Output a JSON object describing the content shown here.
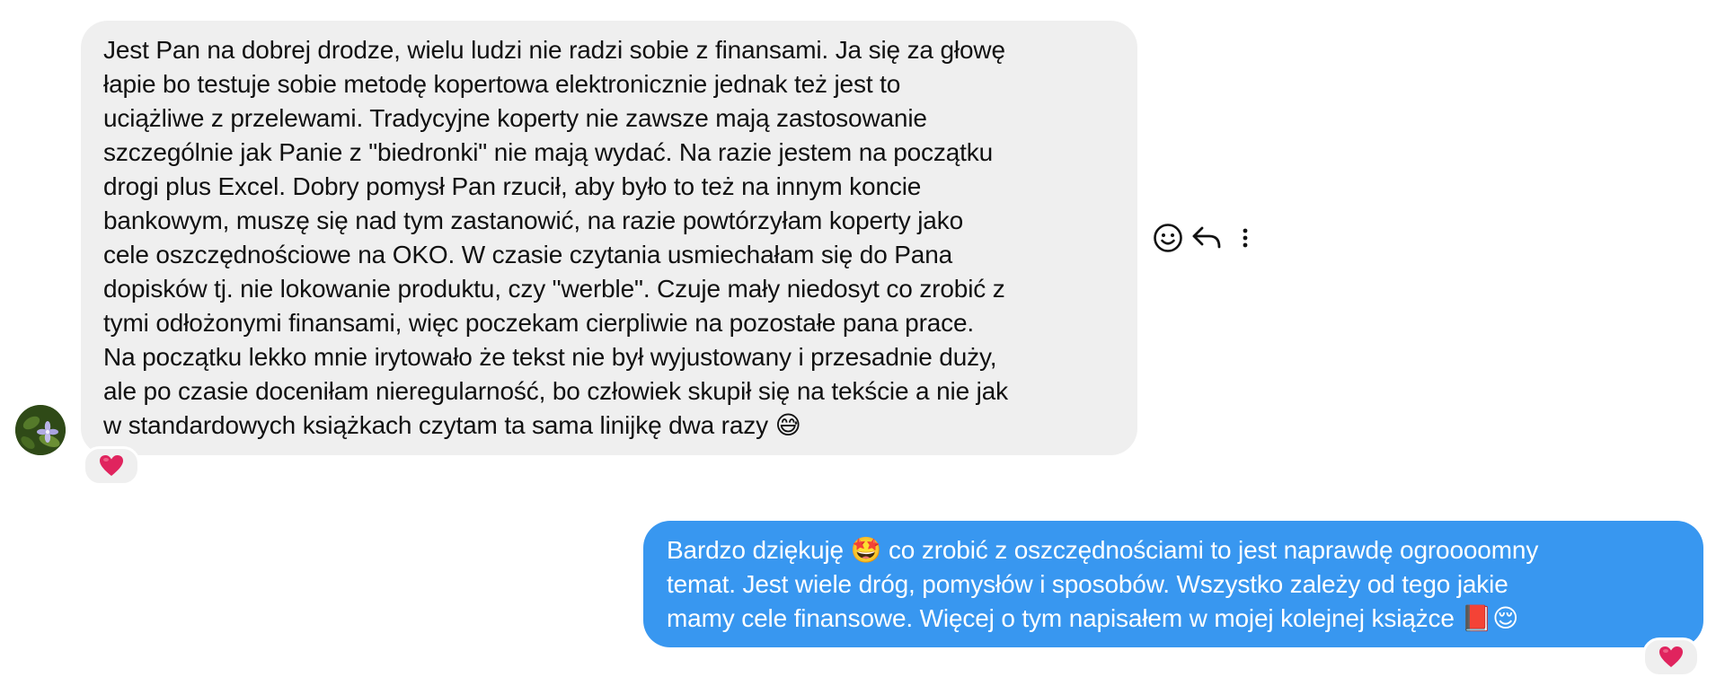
{
  "incoming_message": {
    "lines": [
      "Jest Pan na dobrej drodze, wielu ludzi nie radzi sobie z finansami. Ja się za głowę",
      "łapie bo testuje sobie metodę kopertowa elektronicznie jednak też jest to",
      "uciążliwe z przelewami. Tradycyjne koperty nie zawsze mają zastosowanie",
      "szczególnie jak Panie z \"biedronki\" nie mają wydać. Na razie jestem na początku",
      "drogi plus Excel. Dobry pomysł Pan rzucił, aby było to też na innym koncie",
      "bankowym, muszę się nad tym zastanowić, na razie powtórzyłam koperty jako",
      "cele oszczędnościowe na OKO. W czasie czytania usmiechałam się do Pana",
      "dopisków tj. nie lokowanie produktu, czy \"werble\". Czuje mały niedosyt co zrobić z",
      "tymi odłożonymi finansami, więc poczekam cierpliwie na pozostałe pana prace.",
      "Na początku lekko mnie irytowało że tekst nie był wyjustowany i przesadnie duży,",
      "ale po czasie doceniłam nieregularność, bo człowiek skupił się na tekście a nie jak",
      "w standardowych książkach czytam ta sama linijkę dwa razy 😅"
    ],
    "reaction": "❤️"
  },
  "message_actions": {
    "icons": [
      "emoji-react-icon",
      "reply-icon",
      "more-options-icon"
    ]
  },
  "outgoing_message": {
    "lines": [
      "Bardzo dziękuję 🤩 co zrobić z oszczędnościami to jest naprawdę ogroooomny",
      "temat. Jest wiele dróg, pomysłów i sposobów. Wszystko zależy od tego jakie",
      "mamy cele finansowe. Więcej o tym napisałem w mojej kolejnej książce 📕😌"
    ],
    "reaction": "❤️"
  },
  "colors": {
    "incoming_bubble": "#efefef",
    "outgoing_bubble": "#3897f0",
    "heart": "#e0245e"
  }
}
